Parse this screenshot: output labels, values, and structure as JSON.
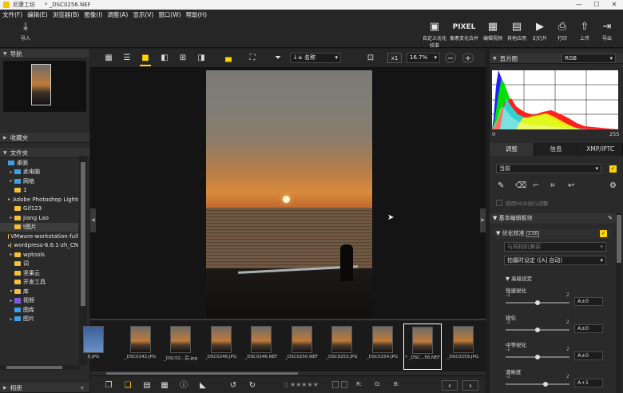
{
  "title_bar": {
    "app_name": "尼康工坊",
    "document": "* _DSC0256.NEF"
  },
  "menu": [
    "文件(F)",
    "编辑(E)",
    "浏览器(B)",
    "图像(I)",
    "调整(A)",
    "显示(V)",
    "窗口(W)",
    "帮助(H)"
  ],
  "toolbar": {
    "import_label": "导入",
    "right_buttons": [
      {
        "name": "custom-icon",
        "label": "自定义优化校准"
      },
      {
        "name": "pixel-icon",
        "glyph": "PIXEL",
        "label": "像素变化合并"
      },
      {
        "name": "edit-video-icon",
        "label": "编辑视频"
      },
      {
        "name": "other-apps-icon",
        "label": "其他应用"
      },
      {
        "name": "slideshow-icon",
        "label": "幻灯片"
      },
      {
        "name": "print-icon",
        "label": "打印"
      },
      {
        "name": "upload-icon",
        "label": "上传"
      },
      {
        "name": "export-icon",
        "label": "导出"
      }
    ]
  },
  "left_panel": {
    "nav_title": "导航",
    "favorites_title": "收藏夹",
    "folders_title": "文件夹",
    "albums_title": "相册",
    "tree": [
      {
        "label": "桌面",
        "kind": "pc",
        "expander": ""
      },
      {
        "label": "此电脑",
        "kind": "pc",
        "expander": "▸"
      },
      {
        "label": "网络",
        "kind": "pc",
        "expander": "▸"
      },
      {
        "label": "1",
        "kind": "folder",
        "expander": ""
      },
      {
        "label": "Adobe Photoshop Lightroom",
        "kind": "folder",
        "expander": "▸"
      },
      {
        "label": "Gif123",
        "kind": "folder",
        "expander": ""
      },
      {
        "label": "Jiang Lao",
        "kind": "folder",
        "expander": "▸"
      },
      {
        "label": "t图片",
        "kind": "folder",
        "expander": "",
        "selected": true
      },
      {
        "label": "VMware-workstation-full",
        "kind": "folder",
        "expander": ""
      },
      {
        "label": "wordpress-6.6.1-zh_CN",
        "kind": "folder",
        "expander": "▸"
      },
      {
        "label": "wptools",
        "kind": "folder",
        "expander": "▸"
      },
      {
        "label": "词",
        "kind": "folder",
        "expander": ""
      },
      {
        "label": "坚果云",
        "kind": "folder",
        "expander": ""
      },
      {
        "label": "开发工具",
        "kind": "folder",
        "expander": ""
      },
      {
        "label": "库",
        "kind": "folder",
        "expander": "▾"
      },
      {
        "label": "视频",
        "kind": "purple",
        "expander": "▸"
      },
      {
        "label": "图库",
        "kind": "pc",
        "expander": ""
      },
      {
        "label": "图片",
        "kind": "pc",
        "expander": "▸"
      }
    ]
  },
  "view_toolbar": {
    "sort_label": "名称",
    "sort_prefix": "↓±",
    "zoom_x1": "x1",
    "zoom_value": "16.7%"
  },
  "filmstrip": [
    {
      "name": "0.JPG"
    },
    {
      "name": "_DSC0242.JPG"
    },
    {
      "name": "_DSC02...后.jpg"
    },
    {
      "name": "_DSC0246.JPG"
    },
    {
      "name": "_DSC0246.NEF"
    },
    {
      "name": "_DSC0250.NEF"
    },
    {
      "name": "_DSC0253.JPG"
    },
    {
      "name": "_DSC0254.JPG"
    },
    {
      "name": "* _DSC...56.NEF",
      "selected": true
    },
    {
      "name": "_DSC0259.JPG"
    }
  ],
  "bottom_bar": {
    "rgb_r": "R:",
    "rgb_g": "G:",
    "rgb_b": "B:"
  },
  "right_panel": {
    "histogram_title": "直方图",
    "histogram_channel": "RGB",
    "hist_min": "0",
    "hist_max": "255",
    "tabs": [
      "调整",
      "信息",
      "XMP/IPTC"
    ],
    "preset": "当前",
    "hdr_label": "使用HDR进行调整",
    "basic_section": "基本编辑板块",
    "picture_control_label": "优化校准",
    "picture_control_badge": "2.00",
    "camera_compat": "与照相机兼容",
    "shooting_setting": "拍摄时设定 ([A] 自动)",
    "advanced_label": "高级设定",
    "sliders": [
      {
        "label": "快速锐化",
        "min": "-2",
        "max": "2",
        "value": "A±0",
        "pos": 0.5
      },
      {
        "label": "锐化",
        "min": "-2",
        "max": "2",
        "value": "A±0",
        "pos": 0.5
      },
      {
        "label": "中等锐化",
        "min": "-2",
        "max": "2",
        "value": "A±0",
        "pos": 0.5
      },
      {
        "label": "清晰度",
        "min": "-2",
        "max": "2",
        "value": "A+1",
        "pos": 0.62
      }
    ]
  }
}
